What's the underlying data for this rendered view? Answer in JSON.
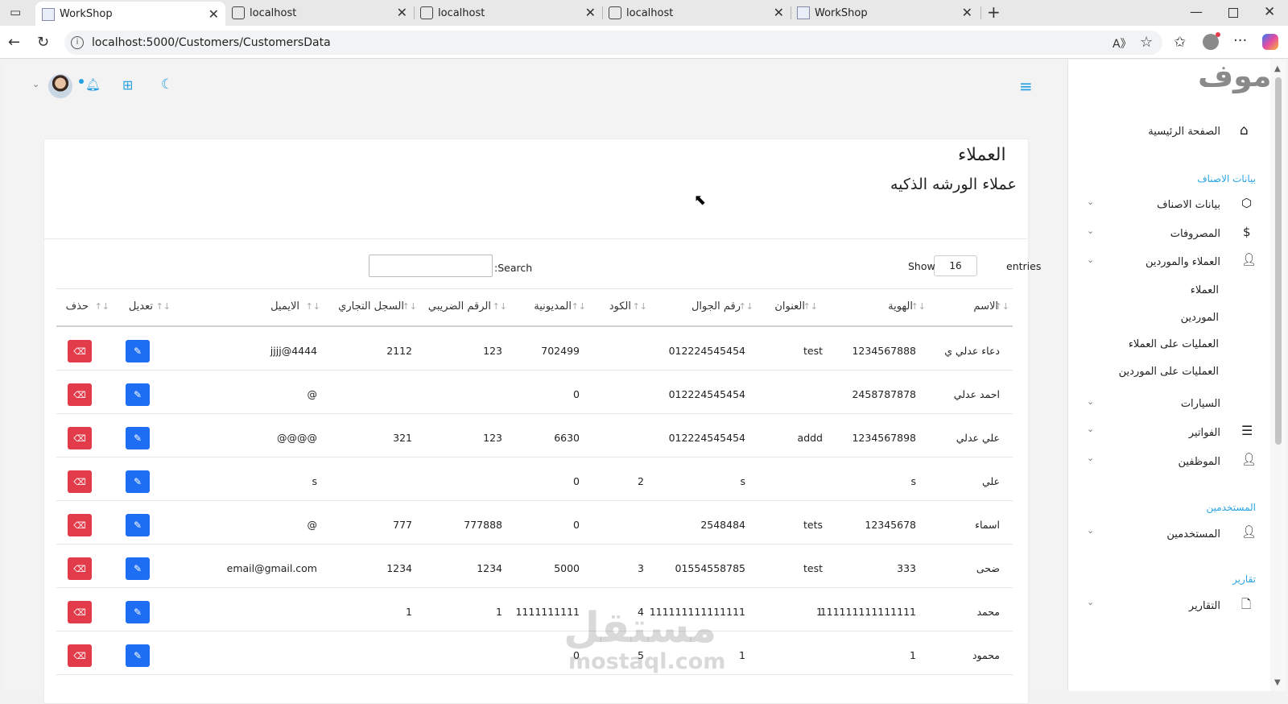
{
  "browser": {
    "tabs": [
      {
        "title": "WorkShop",
        "active": true
      },
      {
        "title": "localhost",
        "active": false
      },
      {
        "title": "localhost",
        "active": false
      },
      {
        "title": "localhost",
        "active": false
      },
      {
        "title": "WorkShop",
        "active": false
      }
    ],
    "url": "localhost:5000/Customers/CustomersData"
  },
  "page": {
    "title": "العملاء",
    "subtitle": "عملاء الورشه الذكيه",
    "show_label": "Show",
    "entries_value": "16",
    "entries_label": "entries",
    "search_label": ":Search",
    "search_value": ""
  },
  "table": {
    "columns": [
      "الاسم",
      "الهوية",
      "العنوان",
      "رقم الجوال",
      "الكود",
      "المديونية",
      "الرقم الضريبي",
      "السجل التجاري",
      "الايميل",
      "تعديل",
      "حذف"
    ],
    "rows": [
      [
        "دعاء عدلي ي",
        "1234567888",
        "test",
        "012224545454",
        "",
        "702499",
        "123",
        "2112",
        "jjjj@4444"
      ],
      [
        "احمد عدلي",
        "2458787878",
        "",
        "012224545454",
        "",
        "0",
        "",
        "",
        "@"
      ],
      [
        "علي عدلي",
        "1234567898",
        "addd",
        "012224545454",
        "",
        "6630",
        "123",
        "321",
        "@@@@"
      ],
      [
        "علي",
        "s",
        "",
        "s",
        "2",
        "0",
        "",
        "",
        "s"
      ],
      [
        "اسماء",
        "12345678",
        "tets",
        "2548484",
        "",
        "0",
        "777888",
        "777",
        "@"
      ],
      [
        "ضحى",
        "333",
        "test",
        "01554558785",
        "3",
        "5000",
        "1234",
        "1234",
        "email@gmail.com"
      ],
      [
        "محمد",
        "111111111111111",
        "1",
        "111111111111111",
        "4",
        "1111111111",
        "1",
        "1",
        ""
      ],
      [
        "محمود",
        "1",
        "",
        "1",
        "5",
        "0",
        "",
        "",
        ""
      ]
    ]
  },
  "sidebar": {
    "logo": "موف",
    "home": "الصفحة الرئيسية",
    "sections": [
      {
        "title": "بيانات الاصناف",
        "items": [
          "بيانات الاصناف",
          "المصروفات",
          "العملاء والموردين"
        ]
      },
      {
        "title": "المستخدمين",
        "items": [
          "المستخدمين"
        ]
      },
      {
        "title": "تقارير",
        "items": [
          "التقارير"
        ]
      }
    ],
    "sub_items": [
      "العملاء",
      "الموردين",
      "العمليات على العملاء",
      "العمليات على الموردين"
    ],
    "more_items": [
      "السيارات",
      "الفواتير",
      "الموظفين"
    ]
  },
  "watermark": {
    "arabic": "مستقل",
    "latin": "mostaql.com"
  }
}
